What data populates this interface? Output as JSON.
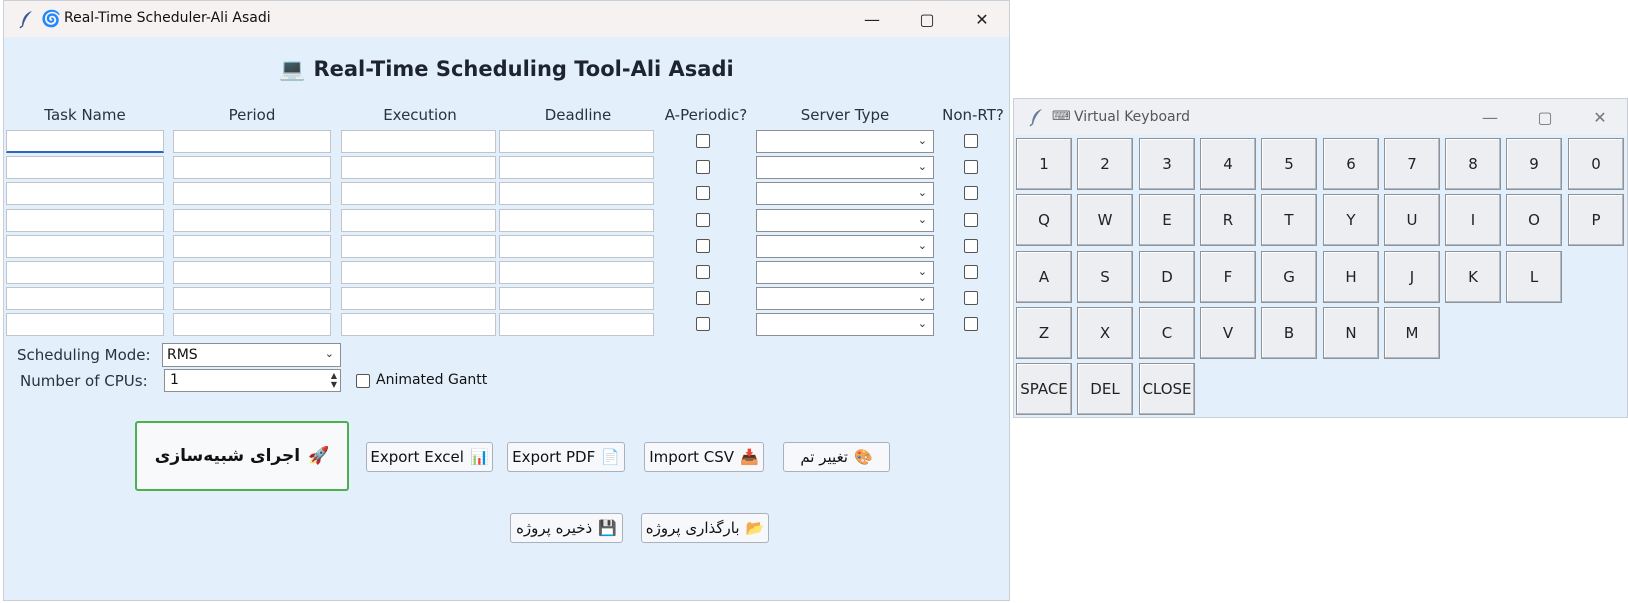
{
  "main_window": {
    "title": "Real-Time Scheduler-Ali Asadi",
    "heading": "Real-Time Scheduling Tool-Ali Asadi",
    "columns": {
      "task_name": "Task Name",
      "period": "Period",
      "execution": "Execution",
      "deadline": "Deadline",
      "aperiodic": "A-Periodic?",
      "server_type": "Server Type",
      "non_rt": "Non-RT?"
    },
    "row_count": 8,
    "scheduling_mode_label": "Scheduling Mode:",
    "scheduling_mode_value": "RMS",
    "cpus_label": "Number of CPUs:",
    "cpus_value": "1",
    "animated_gantt_label": "Animated Gantt",
    "run_button": "اجرای شبیه‌سازی",
    "export_excel": "Export Excel",
    "export_pdf": "Export PDF",
    "import_csv": "Import CSV",
    "change_theme": "تغییر تم",
    "save_project": "ذخیره پروژه",
    "load_project": "بارگذاری پروژه"
  },
  "keyboard_window": {
    "title": "Virtual Keyboard",
    "rows": [
      [
        "1",
        "2",
        "3",
        "4",
        "5",
        "6",
        "7",
        "8",
        "9",
        "0"
      ],
      [
        "Q",
        "W",
        "E",
        "R",
        "T",
        "Y",
        "U",
        "I",
        "O",
        "P"
      ],
      [
        "A",
        "S",
        "D",
        "F",
        "G",
        "H",
        "J",
        "K",
        "L"
      ],
      [
        "Z",
        "X",
        "C",
        "V",
        "B",
        "N",
        "M"
      ],
      [
        "SPACE",
        "DEL",
        "CLOSE"
      ]
    ]
  },
  "icons": {
    "app": "spiral-icon",
    "heading": "laptop-icon",
    "run": "rocket-icon",
    "excel": "bar-chart-icon",
    "pdf": "document-icon",
    "csv": "inbox-icon",
    "theme": "palette-icon",
    "save": "floppy-icon",
    "load": "folder-icon",
    "keyboard": "keyboard-icon"
  }
}
